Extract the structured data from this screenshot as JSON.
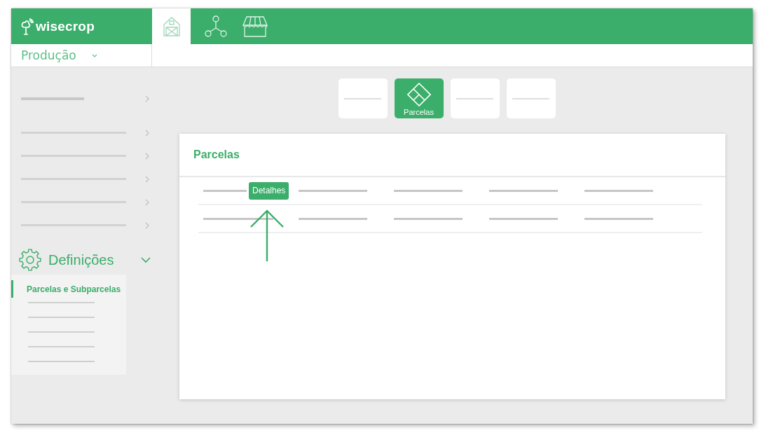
{
  "header": {
    "logo": "wisecrop",
    "nav_tabs": [
      {
        "selected": true
      },
      {
        "selected": false
      },
      {
        "selected": false
      }
    ],
    "module_dropdown": {
      "value": "Produção"
    }
  },
  "sidebar": {
    "items": [
      {
        "kind": "heading",
        "expanded": false
      },
      {
        "kind": "line",
        "expanded": false
      },
      {
        "kind": "line",
        "expanded": false
      },
      {
        "kind": "line",
        "expanded": false
      },
      {
        "kind": "line",
        "expanded": false
      },
      {
        "kind": "line",
        "expanded": false
      },
      {
        "kind": "section",
        "label": "Definições",
        "expanded": true,
        "children": [
          {
            "kind": "link",
            "label": "Parcelas e Subparcelas",
            "selected": true
          },
          {
            "kind": "line",
            "selected": false
          },
          {
            "kind": "line",
            "selected": false
          },
          {
            "kind": "line",
            "selected": false
          },
          {
            "kind": "line",
            "selected": false
          },
          {
            "kind": "line",
            "selected": false
          }
        ]
      }
    ]
  },
  "tiles": [
    {
      "kind": "line",
      "selected": false
    },
    {
      "kind": "icon",
      "label": "Parcelas",
      "selected": true
    },
    {
      "kind": "line",
      "selected": false
    },
    {
      "kind": "line",
      "selected": false
    }
  ],
  "card": {
    "title": "Parcelas",
    "rows": [
      {
        "kind": "line",
        "badge": "Detalhes"
      },
      {
        "kind": "line"
      }
    ]
  }
}
